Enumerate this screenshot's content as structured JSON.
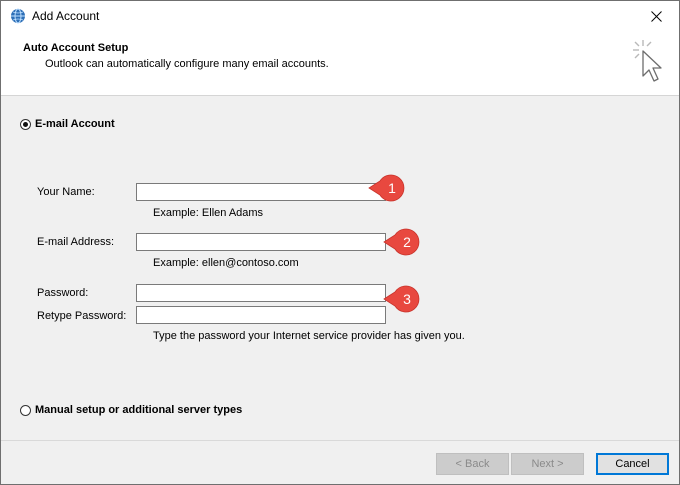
{
  "window": {
    "title": "Add Account",
    "app_icon": "outlook-globe-icon",
    "close_icon": "close-icon"
  },
  "header": {
    "title": "Auto Account Setup",
    "subtitle": "Outlook can automatically configure many email accounts.",
    "icon": "cursor-click-icon"
  },
  "email_account": {
    "label": "E-mail Account",
    "selected": true,
    "fields": {
      "name_label": "Your Name:",
      "name_value": "",
      "name_hint": "Example: Ellen Adams",
      "email_label": "E-mail Address:",
      "email_value": "",
      "email_hint": "Example: ellen@contoso.com",
      "password_label": "Password:",
      "password_value": "",
      "retype_label": "Retype Password:",
      "retype_value": "",
      "password_hint": "Type the password your Internet service provider has given you."
    }
  },
  "manual_setup": {
    "label": "Manual setup or additional server types",
    "selected": false
  },
  "callouts": [
    "1",
    "2",
    "3"
  ],
  "colors": {
    "callout": "#e8483f",
    "default_button_border": "#0078d7"
  },
  "buttons": {
    "back": "< Back",
    "next": "Next >",
    "cancel": "Cancel"
  }
}
